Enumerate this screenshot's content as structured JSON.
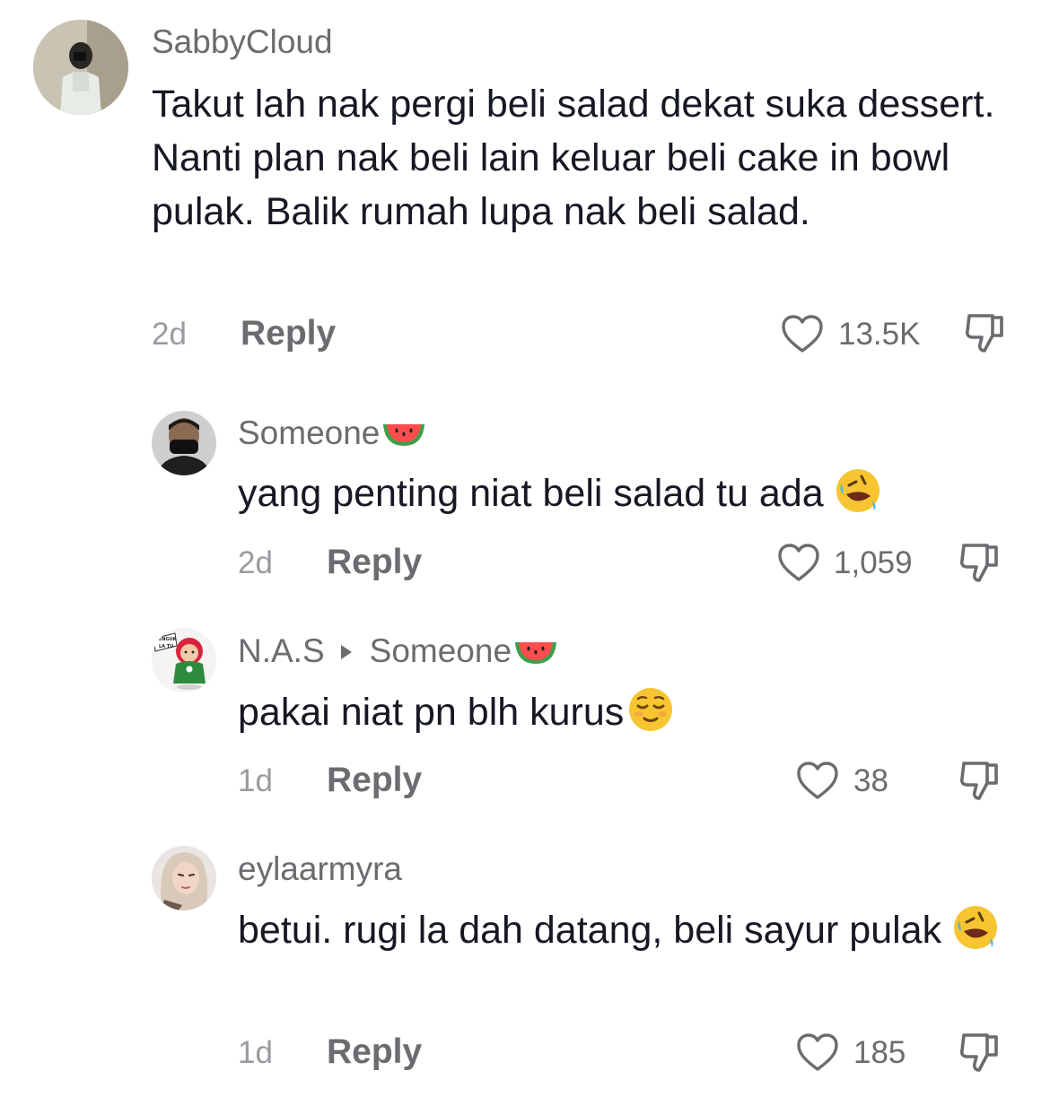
{
  "comments": [
    {
      "username": "SabbyCloud",
      "text": "Takut lah nak pergi beli salad dekat suka dessert. Nanti plan nak beli lain keluar beli cake in bowl pulak. Balik rumah lupa nak beli salad.",
      "time": "2d",
      "reply_label": "Reply",
      "likes": "13.5K"
    },
    {
      "username": "Someone",
      "name_emoji": "watermelon",
      "text": "yang penting niat beli salad tu ada",
      "text_emoji": "rolling-on-floor-laughing",
      "time": "2d",
      "reply_label": "Reply",
      "likes": "1,059"
    },
    {
      "username": "N.A.S",
      "reply_to": "Someone",
      "name_emoji": "watermelon",
      "avatar_label": "JENGUK LA TU",
      "text": "pakai niat pn blh kurus",
      "text_emoji": "relieved-face",
      "time": "1d",
      "reply_label": "Reply",
      "likes": "38"
    },
    {
      "username": "eylaarmyra",
      "text": "betui. rugi la dah datang, beli sayur pulak",
      "text_emoji": "rolling-on-floor-laughing",
      "time": "1d",
      "reply_label": "Reply",
      "likes": "185"
    }
  ],
  "icons": {
    "like": "heart-outline-icon",
    "dislike": "thumbs-down-icon"
  },
  "colors": {
    "username": "#6b6b70",
    "body_text": "#161823",
    "timestamp": "#9a9aa0"
  }
}
